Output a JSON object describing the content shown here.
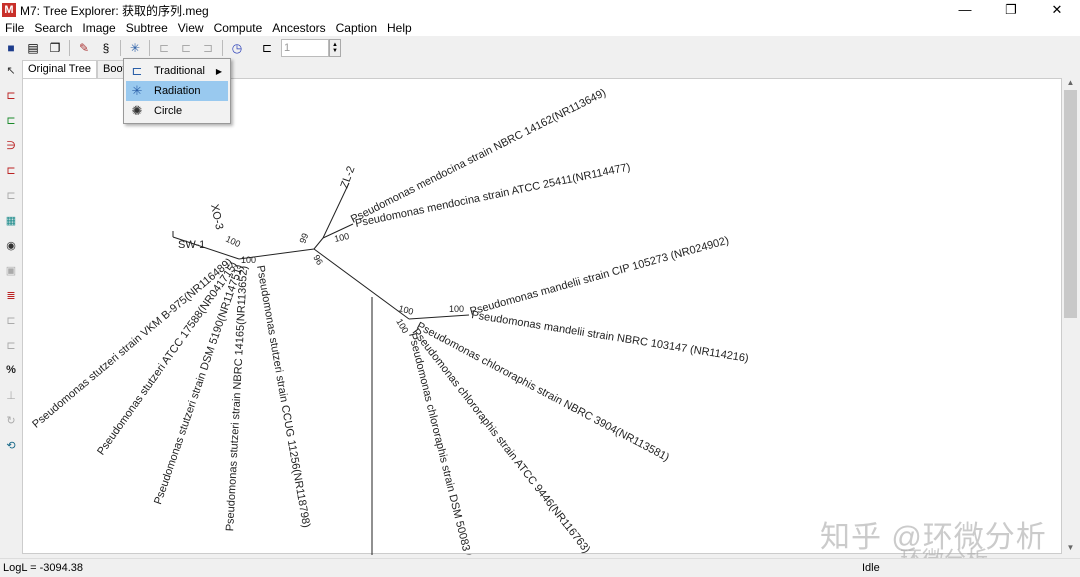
{
  "window": {
    "logo": "M",
    "title": "M7: Tree Explorer: 获取的序列.meg",
    "minimize": "—",
    "restore": "❐",
    "close": "✕"
  },
  "menubar": [
    "File",
    "Search",
    "Image",
    "Subtree",
    "View",
    "Compute",
    "Ancestors",
    "Caption",
    "Help"
  ],
  "toolbar": {
    "spin_value": "1"
  },
  "tabs": [
    "Original Tree",
    "Boots"
  ],
  "view_menu": {
    "items": [
      {
        "label": "Traditional",
        "icon": "traditional-tree-icon",
        "submenu": true
      },
      {
        "label": "Radiation",
        "icon": "radiation-tree-icon",
        "selected": true
      },
      {
        "label": "Circle",
        "icon": "circle-tree-icon"
      }
    ]
  },
  "tree": {
    "taxa": {
      "zl2": "ZL-2",
      "xo3": "XO-3",
      "sw1": "SW-1",
      "mend1": "Pseudomonas mendocina strain NBRC 14162(NR113649)",
      "mend2": "Pseudomonas mendocina strain ATCC 25411(NR114477)",
      "mand1": "Pseudomonas mandelii strain CIP 105273 (NR024902)",
      "mand2": "Pseudomonas mandelii strain NBRC 103147 (NR114216)",
      "chl1": "Pseudomonas chlororaphis strain NBRC 3904(NR113581)",
      "chl2": "Pseudomonas chlororaphis strain ATCC 9446(NR116763)",
      "chl3": "Pseudomonas chlororaphis strain DSM 50083 (",
      "stu1": "Pseudomonas stutzeri strain VKM B-975(NR116489)",
      "stu2": "Pseudomonas stutzeri ATCC 17588(NR041715)",
      "stu3": "Pseudomonas stutzeri strain DSM 5190(NR114751)",
      "stu4": "Pseudomonas stutzeri strain NBRC 14165(NR113652)",
      "stu5": "Pseudomonas stutzeri strain CCUG 11256(NR118798)"
    },
    "bootstrap": {
      "b99": "99",
      "b96": "96",
      "b100a": "100",
      "b100b": "100",
      "b100c": "100",
      "b100d": "100",
      "b100e": "100",
      "b100f": "100"
    }
  },
  "status": {
    "logl": "LogL = -3094.38",
    "state": "Idle"
  },
  "watermark": {
    "line1": "知乎 @环微分析",
    "line2": "环微分析"
  }
}
